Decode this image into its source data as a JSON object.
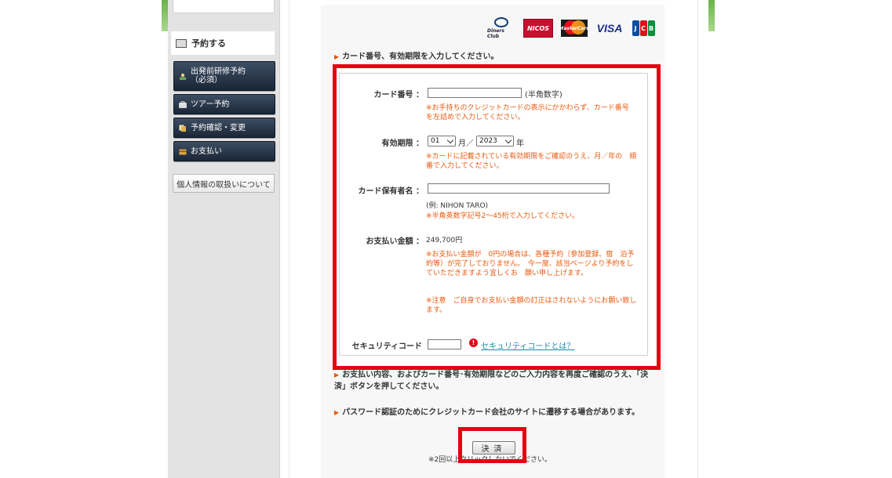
{
  "sidebar": {
    "reserve_heading": "予約する",
    "items": [
      {
        "label": "出発前研修予約\n（必須）",
        "icon": "person-icon"
      },
      {
        "label": "ツアー予約",
        "icon": "briefcase-icon"
      },
      {
        "label": "予約確認・変更",
        "icon": "documents-icon"
      },
      {
        "label": "お支払い",
        "icon": "wallet-icon"
      }
    ],
    "privacy_label": "個人情報の取扱いについて"
  },
  "card_logos": [
    "Diners Club International",
    "NICOS",
    "MasterCard",
    "VISA",
    "JCB"
  ],
  "instructions": {
    "enter_card": "カード番号、有効期限を入力してください。",
    "confirm": "お支払い内容、およびカード番号･有効期限などのご入力内容を再度ご確認のうえ、「決済」ボタンを押してください。",
    "password": "パスワード認証のためにクレジットカード会社のサイトに遷移する場合があります。"
  },
  "form": {
    "card_number": {
      "label": "カード番号 ：",
      "value": "",
      "hint": "(半角数字)",
      "warning": "※お手持ちのクレジットカードの表示にかかわらず、カード番号　を左詰めで入力してください。"
    },
    "expiry": {
      "label": "有効期限 ：",
      "month": "01",
      "month_unit": "月／",
      "year": "2023",
      "year_unit": "年",
      "warning": "※カードに記載されている有効期限をご確認のうえ、月／年の　順番で入力してください。"
    },
    "holder": {
      "label": "カード保有者名 ：",
      "value": "",
      "example": "(例: NIHON TARO)",
      "warning": "※半角英数字記号2～45桁で入力してください。"
    },
    "amount": {
      "label": "お支払い金額 ：",
      "value": "249,700円",
      "warning1": "※お支払い金額が　0円の場合は、各種予約（参加登録、宿　泊予約等）が完了しておりません。　今一度、該当ページより予約をしていただきますよう宜しくお　願い申し上げます。",
      "warning2": "※注意　ご自身でお支払い金額の訂正はされないようにお願い致し　ます。"
    },
    "security": {
      "label": "セキュリティコード",
      "value": "",
      "link": "セキュリティコードとは？"
    }
  },
  "pay_button": "決済",
  "footer_note": "※2回以上クリックしないでください。",
  "colors": {
    "accent_red": "#e60012",
    "warning_orange": "#e8590c",
    "link": "#1a8aa8",
    "nav_dark": "#1a2637"
  }
}
